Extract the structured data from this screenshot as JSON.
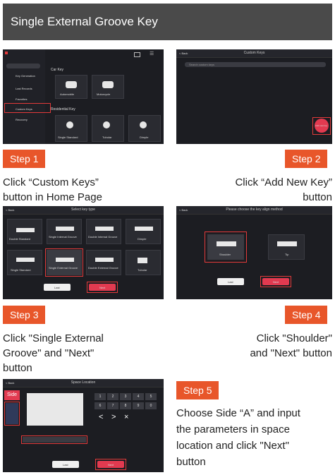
{
  "header": {
    "title": "Single External Groove Key"
  },
  "steps": [
    {
      "label": "Step 1",
      "description_lines": [
        "Click “Custom Keys”",
        "button in Home Page"
      ]
    },
    {
      "label": "Step 2",
      "description_lines": [
        "Click “Add New Key”",
        "button"
      ]
    },
    {
      "label": "Step 3",
      "description_lines": [
        "Click \"Single External",
        "Groove\" and \"Next\"",
        "button"
      ]
    },
    {
      "label": "Step 4",
      "description_lines": [
        "Click \"Shoulder\"",
        "and \"Next\" button"
      ]
    },
    {
      "label": "Step 5",
      "description_lines": [
        "Choose Side “A” and input",
        "the parameters in space",
        "location and click \"Next\"",
        "button"
      ]
    }
  ],
  "screens": {
    "s1": {
      "car_key": "Car Key",
      "residential_key": "Residential Key",
      "automobile": "Automobile",
      "motorcycle": "Motorcycle",
      "single_standard": "Single Standard",
      "tubular": "Tubular",
      "dimple": "Dimple",
      "sidebar": [
        "",
        "Key Generation",
        "Last Records",
        "Favorites",
        "Custom Keys",
        "Recovery"
      ]
    },
    "s2": {
      "back": "< Back",
      "title": "Custom Keys",
      "search": "Search custom keys",
      "add": "Add new key"
    },
    "s3": {
      "back": "< Back",
      "title": "Select key type",
      "types": [
        "Double Standard",
        "Single Internal Groove",
        "Double Internal Groove",
        "Dimple",
        "Single Standard",
        "Single External Groove",
        "Double External Groove",
        "Tubular"
      ],
      "last": "Last",
      "next": "Next"
    },
    "s4": {
      "back": "< Back",
      "title": "Please choose the key align method",
      "shoulder": "Shoulder",
      "tip": "Tip",
      "last": "Last",
      "next": "Next"
    },
    "s5": {
      "back": "< Back",
      "title": "Space Location",
      "side": "Side",
      "keypad": [
        "1",
        "2",
        "3",
        "4",
        "5",
        "6",
        "7",
        "8",
        "9",
        "0"
      ],
      "symbols": [
        "<",
        ">",
        "×"
      ],
      "last": "Last",
      "next": "Next"
    }
  }
}
